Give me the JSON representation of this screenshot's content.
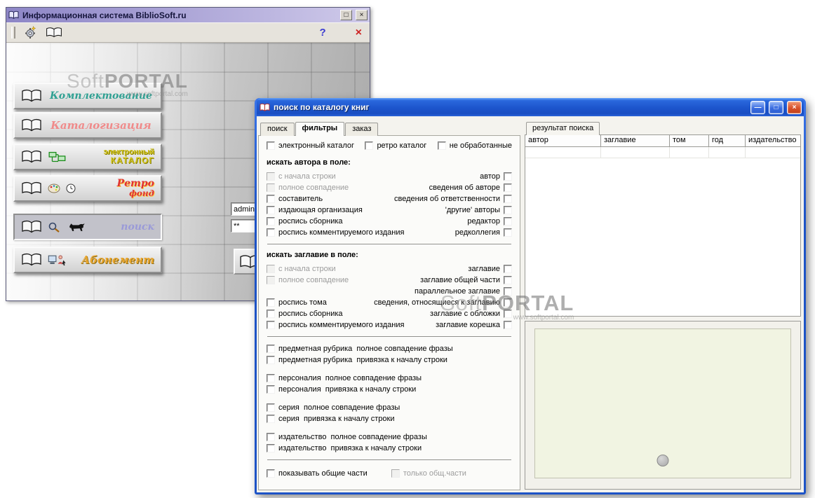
{
  "watermarks": {
    "brand_light": "Soft",
    "brand_bold": "PORTAL",
    "url": "www.softportal.com"
  },
  "back_window": {
    "title": "Информационная система BiblioSoft.ru",
    "buttons": {
      "maximize": "□",
      "close": "×"
    },
    "toolbar": {
      "help": "?",
      "close": "×"
    },
    "sidebar": [
      {
        "label": "Комплектование",
        "color": "#2fa193"
      },
      {
        "label": "Каталогизация",
        "color": "#f08a8a"
      },
      {
        "label": "электронный",
        "label2": "КАТАЛОГ",
        "color": "#d2c41e"
      },
      {
        "label": "Ретро",
        "label2": "фонд",
        "color": "#e03232"
      },
      {
        "label": "поиск",
        "color": "#9a9ad8",
        "pressed": true
      },
      {
        "label": "Абонемент",
        "color": "#eaa62e"
      }
    ],
    "login": {
      "username": "admin",
      "password": "**"
    }
  },
  "dialog": {
    "title": "поиск по каталогу книг",
    "window_buttons": {
      "minimize": "—",
      "maximize": "□",
      "close": "×"
    },
    "tabs": [
      {
        "label": "поиск"
      },
      {
        "label": "фильтры",
        "active": true
      },
      {
        "label": "заказ"
      }
    ],
    "result": {
      "tab_label": "результат поиска",
      "columns": [
        "автор",
        "заглавие",
        "том",
        "год",
        "издательство"
      ]
    },
    "filters": {
      "top_checks": [
        {
          "label": "электронный каталог"
        },
        {
          "label": "ретро каталог"
        },
        {
          "label": "не обработанные"
        }
      ],
      "author_section_header": "искать автора в поле:",
      "author_rows": [
        {
          "left": "с начала строки",
          "left_disabled": true,
          "right": "автор"
        },
        {
          "left": "полное совпадение",
          "left_disabled": true,
          "right": "сведения об авторе"
        },
        {
          "left": "составитель",
          "right": "сведения об ответственности"
        },
        {
          "left": "издающая организация",
          "right": "'другие' авторы"
        },
        {
          "left": "роспись сборника",
          "right": "редактор"
        },
        {
          "left": "роспись комментируемого издания",
          "right": "редколлегия"
        }
      ],
      "title_section_header": "искать заглавие в поле:",
      "title_rows": [
        {
          "left": "с начала строки",
          "left_disabled": true,
          "right": "заглавие"
        },
        {
          "left": "полное совпадение",
          "left_disabled": true,
          "right": "заглавие общей части"
        },
        {
          "left": "",
          "left_empty": true,
          "right": "параллельное заглавие"
        },
        {
          "left": "роспись тома",
          "right": "сведения, относящиеся к заглавию"
        },
        {
          "left": "роспись сборника",
          "right": "заглавие с обложки"
        },
        {
          "left": "роспись комментируемого издания",
          "right": "заглавие корешка"
        }
      ],
      "phrase_checks": [
        {
          "label": "предметная рубрика  полное совпадение фразы"
        },
        {
          "label": "предметная рубрика  привязка к началу строки"
        },
        {
          "label": "персоналия  полное совпадение фразы",
          "gap": true
        },
        {
          "label": "персоналия  привязка к началу строки"
        },
        {
          "label": "серия  полное совпадение фразы",
          "gap": true
        },
        {
          "label": "серия  привязка к началу строки"
        },
        {
          "label": "издательство  полное совпадение фразы",
          "gap": true
        },
        {
          "label": "издательство  привязка к началу строки"
        }
      ],
      "bottom_checks": [
        {
          "label": "показывать общие части"
        },
        {
          "label": "только общ.части",
          "disabled": true
        }
      ]
    }
  }
}
